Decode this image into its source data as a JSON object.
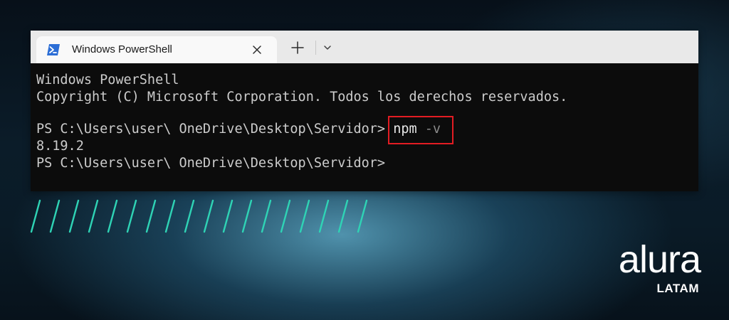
{
  "window": {
    "tab_title": "Windows PowerShell",
    "tab_icon": "powershell-icon",
    "close_icon": "close-icon",
    "new_tab_icon": "plus-icon",
    "dropdown_icon": "chevron-down-icon"
  },
  "terminal": {
    "header_line1": "Windows PowerShell",
    "header_line2": "Copyright (C) Microsoft Corporation. Todos los derechos reservados.",
    "prompt1": "PS C:\\Users\\user\\ OneDrive\\Desktop\\Servidor> ",
    "command": "npm",
    "command_arg": " -v",
    "output": "8.19.2",
    "prompt2": "PS C:\\Users\\user\\ OneDrive\\Desktop\\Servidor>"
  },
  "colors": {
    "terminal_bg": "#0c0c0c",
    "terminal_text": "#cccccc",
    "highlight_border": "#e31c23",
    "accent_slashes": "#2fd3b5",
    "titlebar_bg": "#e9e9e9"
  },
  "branding": {
    "logo_word": "alura",
    "logo_sub": "LATAM"
  }
}
